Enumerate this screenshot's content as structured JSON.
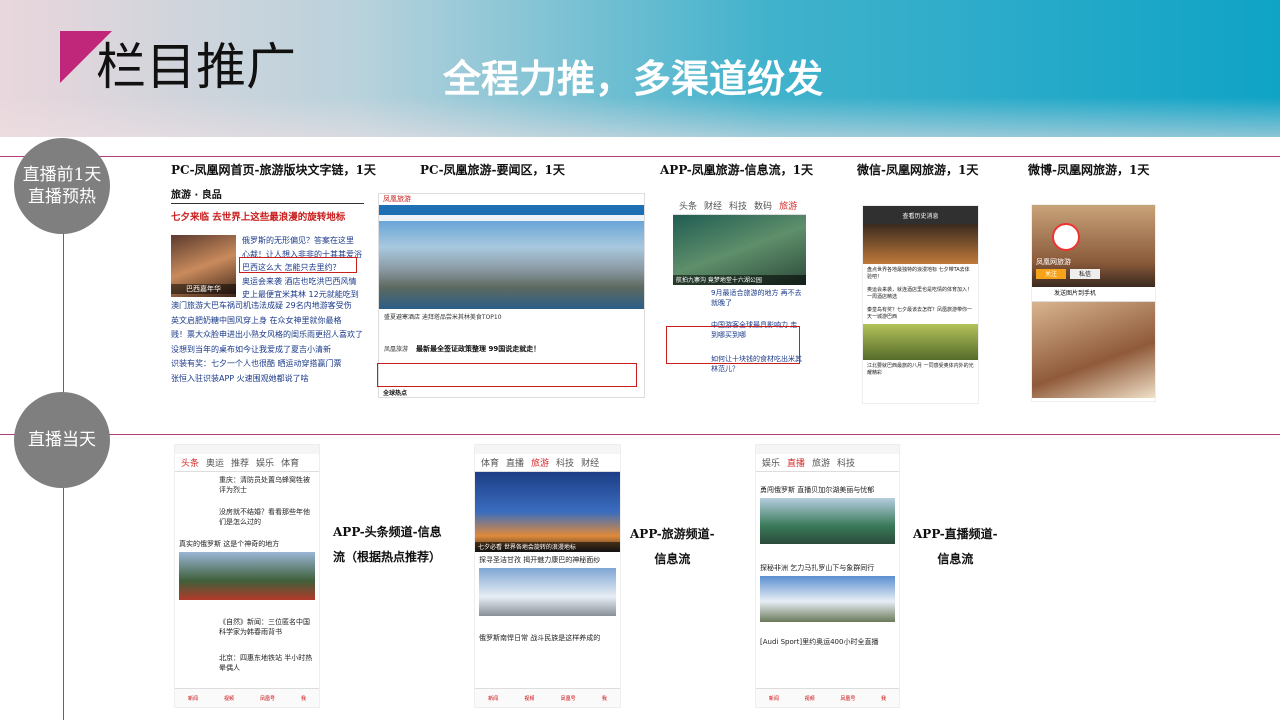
{
  "header": {
    "title": "栏目推广",
    "slogan": "全程力推，多渠道纷发"
  },
  "stages": [
    {
      "label_line1": "直播前1天",
      "label_line2": "直播预热"
    },
    {
      "label_line1": "直播当天",
      "label_line2": ""
    }
  ],
  "row1_captions": [
    "PC-凤凰网首页-旅游版块文字链，1天",
    "PC-凤凰旅游-要闻区，1天",
    "APP-凤凰旅游-信息流，1天",
    "微信-凤凰网旅游，1天",
    "微博-凤凰网旅游，1天"
  ],
  "row2_captions": [
    {
      "line1": "APP-头条频道-信息",
      "line2": "流（根据热点推荐）"
    },
    {
      "line1": "APP-旅游频道-",
      "line2": "信息流"
    },
    {
      "line1": "APP-直播频道-",
      "line2": "信息流"
    }
  ],
  "pc_home": {
    "section": "旅游 · 良品",
    "headline": "七夕来临 去世界上这些最浪漫的旋转地标",
    "image_caption": "巴西嘉年华",
    "side_lines": [
      "俄罗斯的无形偏见？答案在这里",
      "心裁！让人想入非非的十其其爱浴",
      "巴西这么大 怎能只去里约？",
      "奥运会来袭 酒店也吃洪巴西风情",
      "史上最便宜米其林 12元就能吃到"
    ],
    "list": [
      "澳门旅游大巴车祸司机违法成疑 29名内地游客受伤",
      "英文启肥奶糖中国风穿上身 在众女神里就你最格",
      "贱！票大众脸申进出小熟女风格的闺乐雨更招人喜欢了",
      "没想到当年的桌布如今让我爱成了夏吉小清新",
      "识装有奖：七夕一个人也很酷 晒运动穿搭赢门票",
      "张恒入驻识装APP 火速围观她都说了啥"
    ]
  },
  "pc_travel": {
    "logo": "凤凰旅游",
    "caption": "盛夏避寒酒店 迪拜塔品尝米其林美食TOP10",
    "news_title": "最新最全签证政策整理 99国说走就走！",
    "section_label": "凤凰旅游",
    "footer": "全球热点"
  },
  "app_travel": {
    "tabs": [
      "头条",
      "财经",
      "科技",
      "数码",
      "旅游"
    ],
    "img_caption": "航拍九寨沟 竟梦地堂十六湖公园",
    "items": [
      "9月最适合旅游的地方 再不去就晚了",
      "中国游客全球最具影响力 走到哪买到哪",
      "如何让十块钱的食材吃出米其林范儿？"
    ]
  },
  "wechat": {
    "header": "查看历史消息",
    "items": [
      "盘点世界各地最独特的浪漫地标 七夕带TA去体验吧！",
      "奥运会来袭，就连酒店里也是吃情的体育加入！一周酒店精选",
      "秦皇岛有奖？七夕最该去怎样？凤凰旅游带你一天一城游巴西",
      "江北要就巴西最旅的八月 一同感受奥体内外的光耀精彩"
    ]
  },
  "weibo": {
    "name": "凤凰网旅游",
    "follow": "关注",
    "message": "私信",
    "post_label": "发送图片到手机"
  },
  "app_toutiao": {
    "tabs": [
      "头条",
      "奥运",
      "推荐",
      "娱乐",
      "体育"
    ],
    "items": [
      "重庆：清防员处置乌蜂窝牲被评为烈士",
      "没房就不结婚？看看那些年他们是怎么过的",
      "真实的俄罗斯 这是个神奇的地方",
      "《自然》新闻：三位匿名中国科学家为韩春雨背书",
      "北京：四惠东地铁站 半小时热晕偶人"
    ],
    "nav": [
      "新闻",
      "视频",
      "凤凰号",
      "我"
    ]
  },
  "app_travel2": {
    "tabs": [
      "体育",
      "直播",
      "旅游",
      "科技",
      "财经"
    ],
    "img_caption": "七夕必看 世界各地会旋转的浪漫地标",
    "items": [
      "探寻圣洁甘孜 揭开魅力康巴的神秘面纱",
      "俄罗斯南悍日常 战斗民族是这样养成的"
    ],
    "nav": [
      "新闻",
      "视频",
      "凤凰号",
      "我"
    ]
  },
  "app_live": {
    "tabs": [
      "娱乐",
      "直播",
      "旅游",
      "科技"
    ],
    "items": [
      "勇闯俄罗斯 直播贝加尔湖美丽与忧郁",
      "探秘非洲 乞力马扎罗山下与象群同行",
      "[Audi Sport]里约奥运400小时全直播"
    ],
    "nav": [
      "新闻",
      "视频",
      "凤凰号",
      "我"
    ]
  }
}
